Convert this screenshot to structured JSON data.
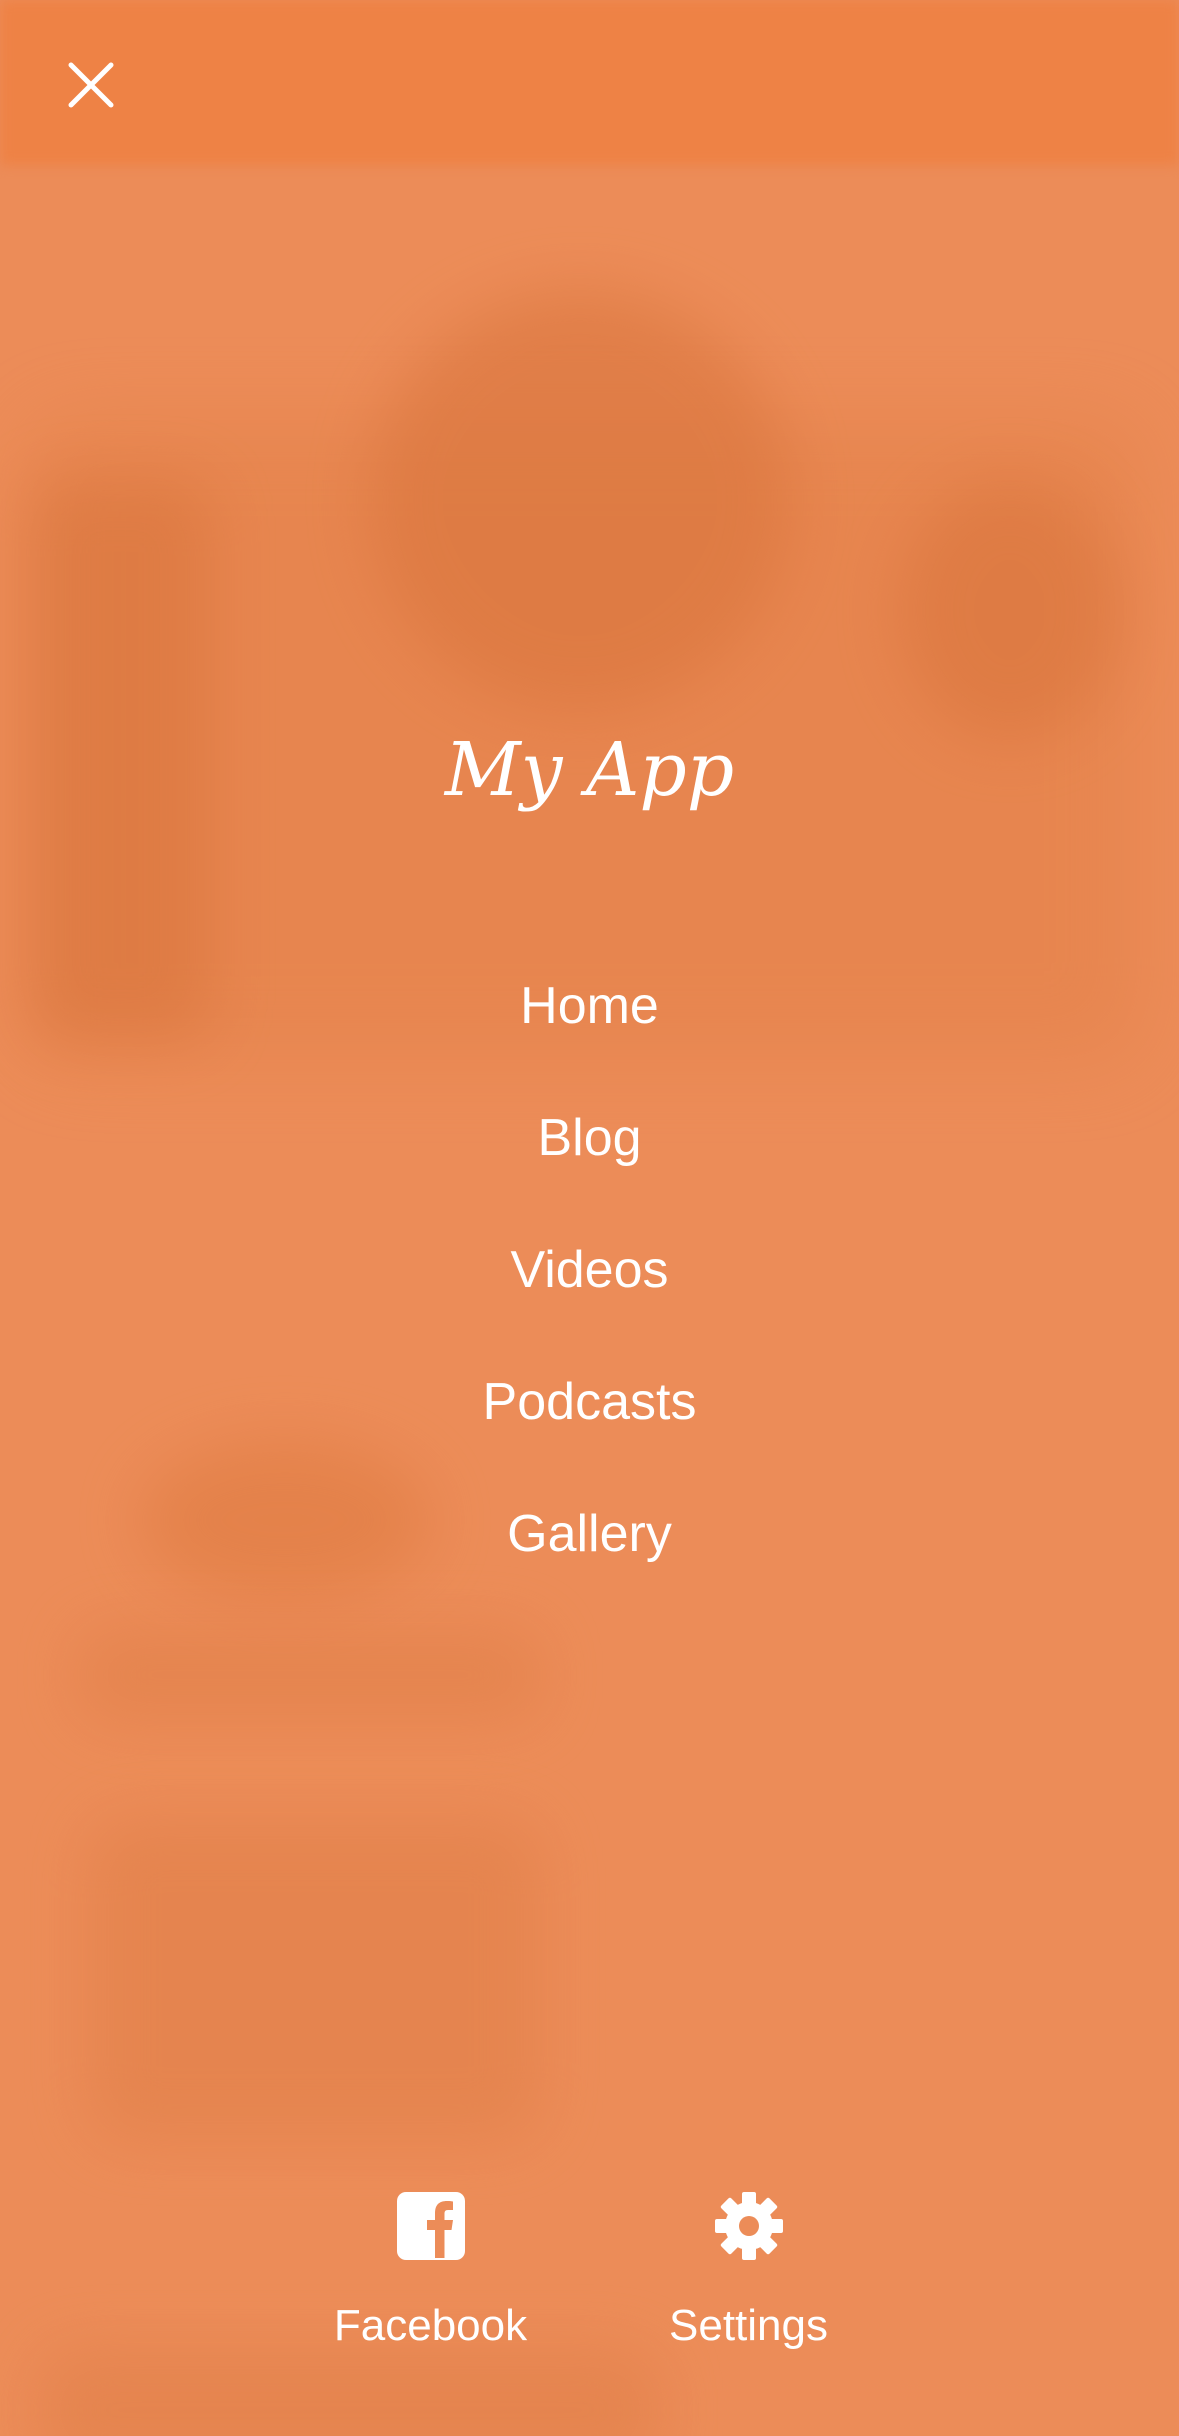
{
  "app": {
    "title": "My App"
  },
  "menu": {
    "items": [
      {
        "label": "Home"
      },
      {
        "label": "Blog"
      },
      {
        "label": "Videos"
      },
      {
        "label": "Podcasts"
      },
      {
        "label": "Gallery"
      }
    ]
  },
  "footer": {
    "facebook": {
      "label": "Facebook",
      "icon": "facebook-icon"
    },
    "settings": {
      "label": "Settings",
      "icon": "gear-icon"
    }
  },
  "header": {
    "close_icon": "close-icon"
  },
  "colors": {
    "background": "#ec8c58",
    "accent": "#ee8245",
    "text": "#ffffff"
  }
}
